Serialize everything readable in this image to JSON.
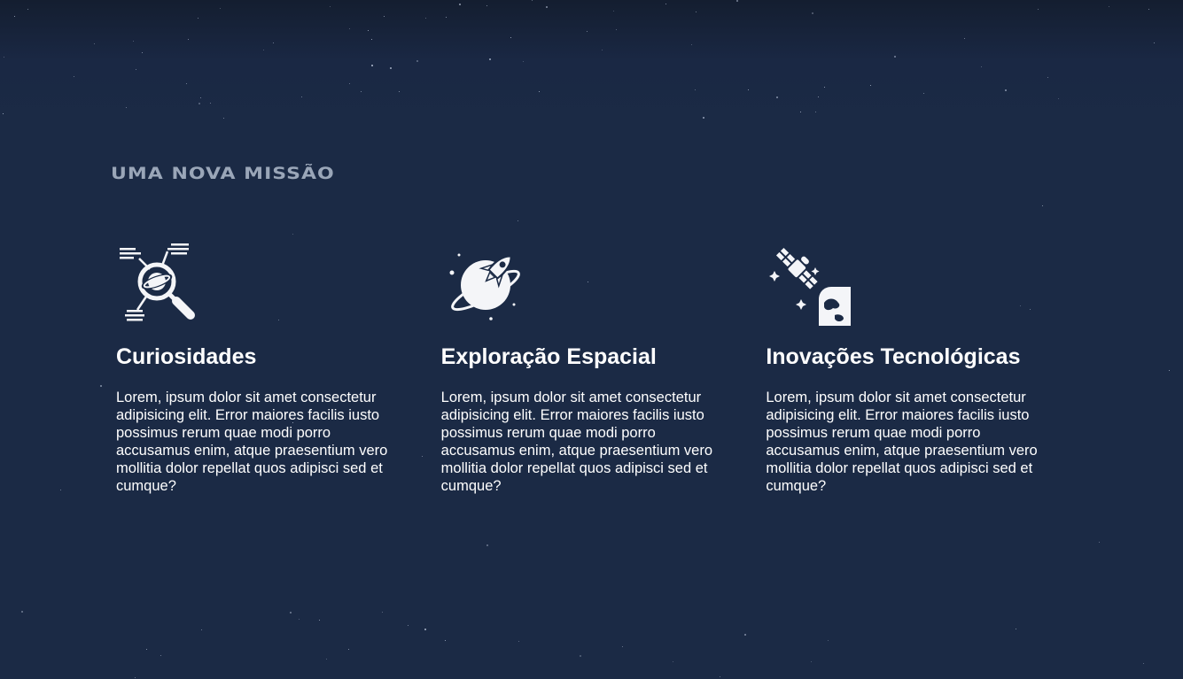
{
  "section": {
    "title": "Uma Nova Missão"
  },
  "cards": [
    {
      "icon": "planet-search-icon",
      "title": "Curiosidades",
      "text": "Lorem, ipsum dolor sit amet consectetur adipisicing elit. Error maiores facilis iusto possimus rerum quae modi porro accusamus enim, atque praesentium vero mollitia dolor repellat quos adipisci sed et cumque?"
    },
    {
      "icon": "rocket-planet-icon",
      "title": "Exploração Espacial",
      "text": "Lorem, ipsum dolor sit amet consectetur adipisicing elit. Error maiores facilis iusto possimus rerum quae modi porro accusamus enim, atque praesentium vero mollitia dolor repellat quos adipisci sed et cumque?"
    },
    {
      "icon": "satellite-earth-icon",
      "title": "Inovações Tecnológicas",
      "text": "Lorem, ipsum dolor sit amet consectetur adipisicing elit. Error maiores facilis iusto possimus rerum quae modi porro accusamus enim, atque praesentium vero mollitia dolor repellat quos adipisci sed et cumque?"
    }
  ],
  "colors": {
    "background": "#1b2a45",
    "title": "#9aa6b8",
    "text": "#ffffff"
  }
}
